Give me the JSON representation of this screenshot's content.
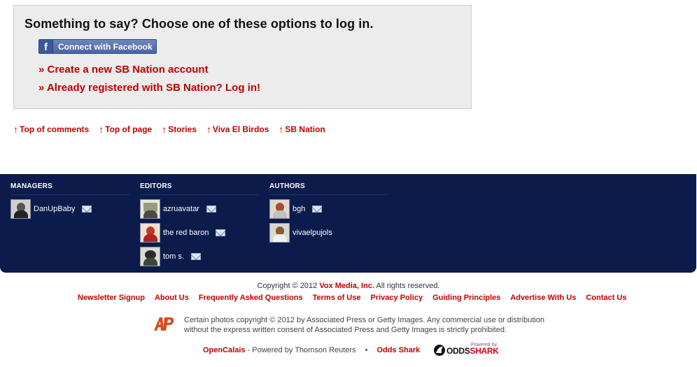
{
  "login": {
    "title": "Something to say? Choose one of these options to log in.",
    "facebook_label": "Connect with Facebook",
    "facebook_letter": "f",
    "create_account": "» Create a new SB Nation account",
    "already_registered": "» Already registered with SB Nation? Log in!"
  },
  "nav": {
    "arrow": "↑",
    "links": [
      "Top of comments",
      "Top of page",
      "Stories",
      "Viva El Birdos",
      "SB Nation"
    ]
  },
  "masthead": {
    "managers": {
      "heading": "MANAGERS",
      "members": [
        {
          "name": "DanUpBaby"
        }
      ]
    },
    "editors": {
      "heading": "EDITORS",
      "members": [
        {
          "name": "azruavatar"
        },
        {
          "name": "the red baron"
        },
        {
          "name": "tom s."
        }
      ]
    },
    "authors": {
      "heading": "AUTHORS",
      "members": [
        {
          "name": "bgh"
        },
        {
          "name": "vivaelpujols"
        }
      ]
    }
  },
  "footer": {
    "copyright_prefix": "Copyright © 2012",
    "copyright_company": "Vox Media, Inc.",
    "copyright_suffix": "All rights reserved.",
    "links": [
      "Newsletter Signup",
      "About Us",
      "Frequently Asked Questions",
      "Terms of Use",
      "Privacy Policy",
      "Guiding Principles",
      "Advertise With Us",
      "Contact Us"
    ],
    "ap_line1": "Certain photos copyright © 2012 by Associated Press or Getty Images. Any commercial use or distribution",
    "ap_line2": "without the express written consent of Associated Press and Getty Images is strictly prohibited.",
    "ap_logo_text": "AP",
    "opencalais": "OpenCalais",
    "powered_by": "- Powered by Thomson Reuters",
    "bullet": "•",
    "odds_shark": "Odds Shark",
    "os_powered_by": "Powered by",
    "os_logo_odds": "ODDS",
    "os_logo_shark": "SHARK"
  },
  "colors": {
    "accent_red": "#c00000",
    "masthead_bg": "#0b1c4c",
    "facebook_blue": "#3b5998"
  }
}
